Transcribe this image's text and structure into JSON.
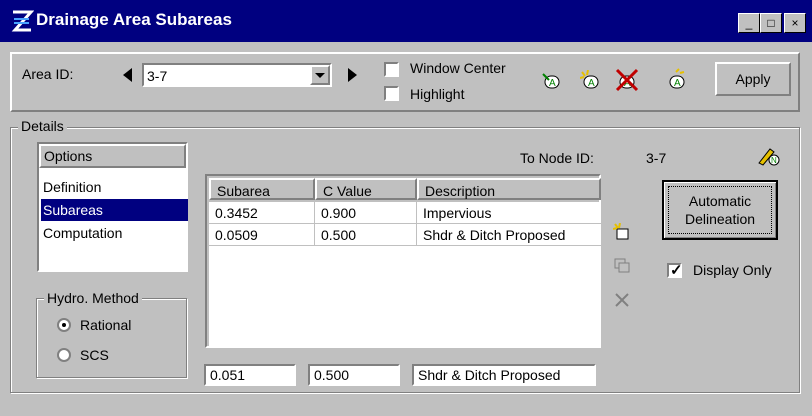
{
  "window": {
    "title": "Drainage Area Subareas",
    "controls": [
      "_",
      "□",
      "×"
    ]
  },
  "top": {
    "area_id_label": "Area ID:",
    "area_id_value": "3-7",
    "window_center_label": "Window Center",
    "window_center_checked": false,
    "highlight_label": "Highlight",
    "highlight_checked": false,
    "apply_label": "Apply"
  },
  "details": {
    "group_label": "Details",
    "options_header": "Options",
    "options": [
      "Definition",
      "Subareas",
      "Computation"
    ],
    "selected_option": 1,
    "to_node_label": "To Node ID:",
    "to_node_value": "3-7",
    "hydro_group_label": "Hydro. Method",
    "hydro_methods": [
      "Rational",
      "SCS"
    ],
    "hydro_selected": 0,
    "grid": {
      "columns": [
        "Subarea",
        "C Value",
        "Description"
      ],
      "rows": [
        [
          "0.3452",
          "0.900",
          "Impervious"
        ],
        [
          "0.0509",
          "0.500",
          "Shdr & Ditch Proposed"
        ]
      ]
    },
    "edit_subarea": "0.051",
    "edit_cvalue": "0.500",
    "edit_description": "Shdr & Ditch Proposed",
    "auto_button": "Automatic Delineation",
    "display_only_label": "Display Only",
    "display_only_checked": true
  },
  "colors": {
    "title_bg": "#000080",
    "face": "#c0c0c0",
    "selection": "#000080"
  }
}
